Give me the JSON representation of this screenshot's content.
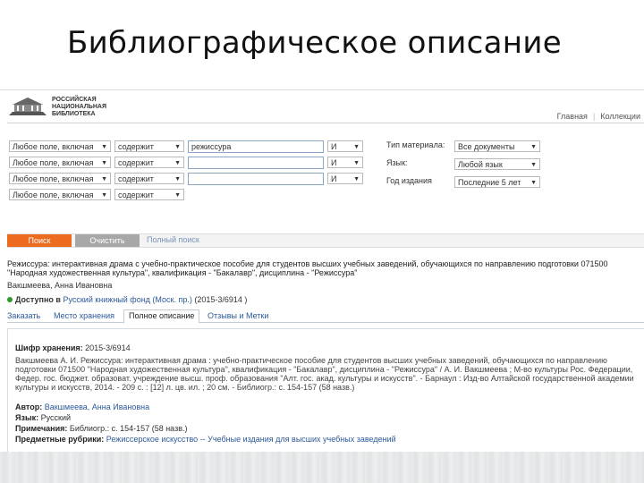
{
  "slide_title": "Библиографическое описание",
  "header": {
    "logo_lines": [
      "Российская",
      "национальная",
      "библиотека"
    ],
    "links": [
      "Главная",
      "Коллекции"
    ]
  },
  "search": {
    "rows": [
      {
        "field": "Любое поле, включая",
        "op": "содержит",
        "value": "режиссура",
        "logic": "И"
      },
      {
        "field": "Любое поле, включая",
        "op": "содержит",
        "value": "",
        "logic": "И"
      },
      {
        "field": "Любое поле, включая",
        "op": "содержит",
        "value": "",
        "logic": "И"
      },
      {
        "field": "Любое поле, включая",
        "op": "содержит",
        "value": "",
        "logic": ""
      }
    ],
    "filters": [
      {
        "label": "Тип материала:",
        "value": "Все документы"
      },
      {
        "label": "Язык:",
        "value": "Любой язык"
      },
      {
        "label": "Год издания",
        "value": "Последние 5 лет"
      }
    ],
    "search_button": "Поиск",
    "clear_button": "Очистить",
    "full_link": "Полный поиск"
  },
  "record": {
    "title": "Режиссура: интерактивная драма с учебно-практическое пособие для студентов высших учебных заведений, обучающихся по направлению подготовки 071500 \"Народная художественная культура\", квалификация - \"Бакалавр\", дисциплина - \"Режиссура\"",
    "author": "Вакшмеева, Анна Ивановна",
    "availability_label": "Доступно в",
    "availability_link": "Русский книжный фонд (Моск. пр.)",
    "availability_code": "(2015-3/6914 )"
  },
  "tabs": [
    "Заказать",
    "Место хранения",
    "Полное описание",
    "Отзывы и Метки"
  ],
  "active_tab": 2,
  "details": {
    "shelf_label": "Шифр хранения:",
    "shelf_value": "2015-3/6914",
    "description": "Вакшмеева А. И. Режиссура: интерактивная драма : учебно-практическое пособие для студентов высших учебных заведений, обучающихся по направлению подготовки 071500 \"Народная художественная культура\", квалификация - \"Бакалавр\", дисциплина - \"Режиссура\" / А. И. Вакшмеева ; М-во культуры Рос. Федерации, Федер. гос. бюджет. образоват. учреждение высш. проф. образования \"Алт. гос. акад. культуры и искусств\". - Барнаул : Изд-во Алтайской государственной академии культуры и искусств, 2014. - 209 с. : [12] л. цв. ил. ; 20 см. - Библиогр.: с. 154-157 (58 назв.)",
    "author_label": "Автор:",
    "author_value": "Вакшмеева, Анна Ивановна",
    "lang_label": "Язык:",
    "lang_value": "Русский",
    "notes_label": "Примечания:",
    "notes_value": "Библиогр.: с. 154-157 (58 назв.)",
    "subject_label": "Предметные рубрики:",
    "subject_value": "Режиссерское искусство -- Учебные издания для высших учебных заведений"
  }
}
